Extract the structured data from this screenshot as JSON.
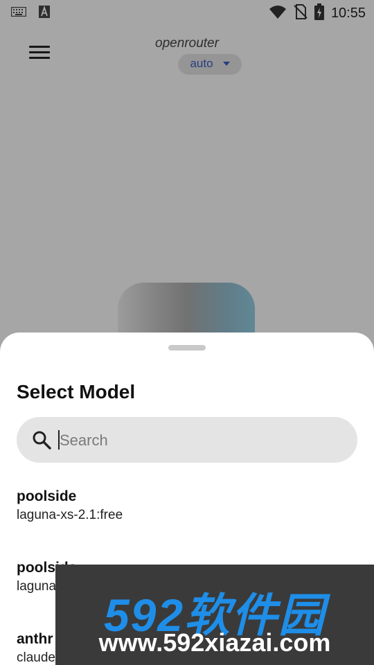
{
  "status_bar": {
    "time": "10:55",
    "left_icons": [
      "keyboard-icon",
      "font-a-icon"
    ],
    "right_icons": [
      "wifi-icon",
      "no-sim-icon",
      "battery-charging-icon"
    ]
  },
  "app_bar": {
    "provider": "openrouter",
    "model_selector": "auto",
    "menu_icon": "hamburger-menu-icon"
  },
  "sheet": {
    "title": "Select Model",
    "search": {
      "placeholder": "Search",
      "value": ""
    },
    "items": [
      {
        "provider": "poolside",
        "model": "laguna-xs-2.1:free"
      },
      {
        "provider": "poolside",
        "model": "laguna"
      },
      {
        "provider": "anthr",
        "model": "claude"
      }
    ]
  },
  "watermark": {
    "brand": "592软件园",
    "url": "www.592xiazai.com"
  },
  "colors": {
    "accent": "#3b5bbf",
    "scrim": "rgba(0,0,0,0.32)",
    "watermark_blue": "#1e8ee8"
  }
}
